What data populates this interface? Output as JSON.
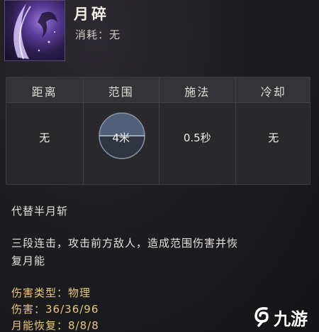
{
  "skill": {
    "name": "月碎",
    "cost": "消耗：无",
    "icon": "crescent-moon-slash-icon"
  },
  "stats": [
    {
      "label": "距离",
      "value": "无"
    },
    {
      "label": "范围",
      "value": "4米"
    },
    {
      "label": "施法",
      "value": "0.5秒"
    },
    {
      "label": "冷却",
      "value": "无"
    }
  ],
  "description": {
    "replaces": "代替半月斩",
    "text_line1": "三段连击，攻击前方敌人，造成范围伤害并恢",
    "text_line2": "复月能"
  },
  "attributes": [
    {
      "label": "伤害类型：",
      "value": "物理"
    },
    {
      "label": "伤害：",
      "value": "36/36/96"
    },
    {
      "label": "月能恢复：",
      "value": "8/8/8"
    }
  ],
  "watermark": {
    "text": "九游",
    "icon": "swirl-logo-icon"
  },
  "colors": {
    "accent": "#e8c87c",
    "panel": "#29282b",
    "icon_purple": "#6b4ab0"
  }
}
